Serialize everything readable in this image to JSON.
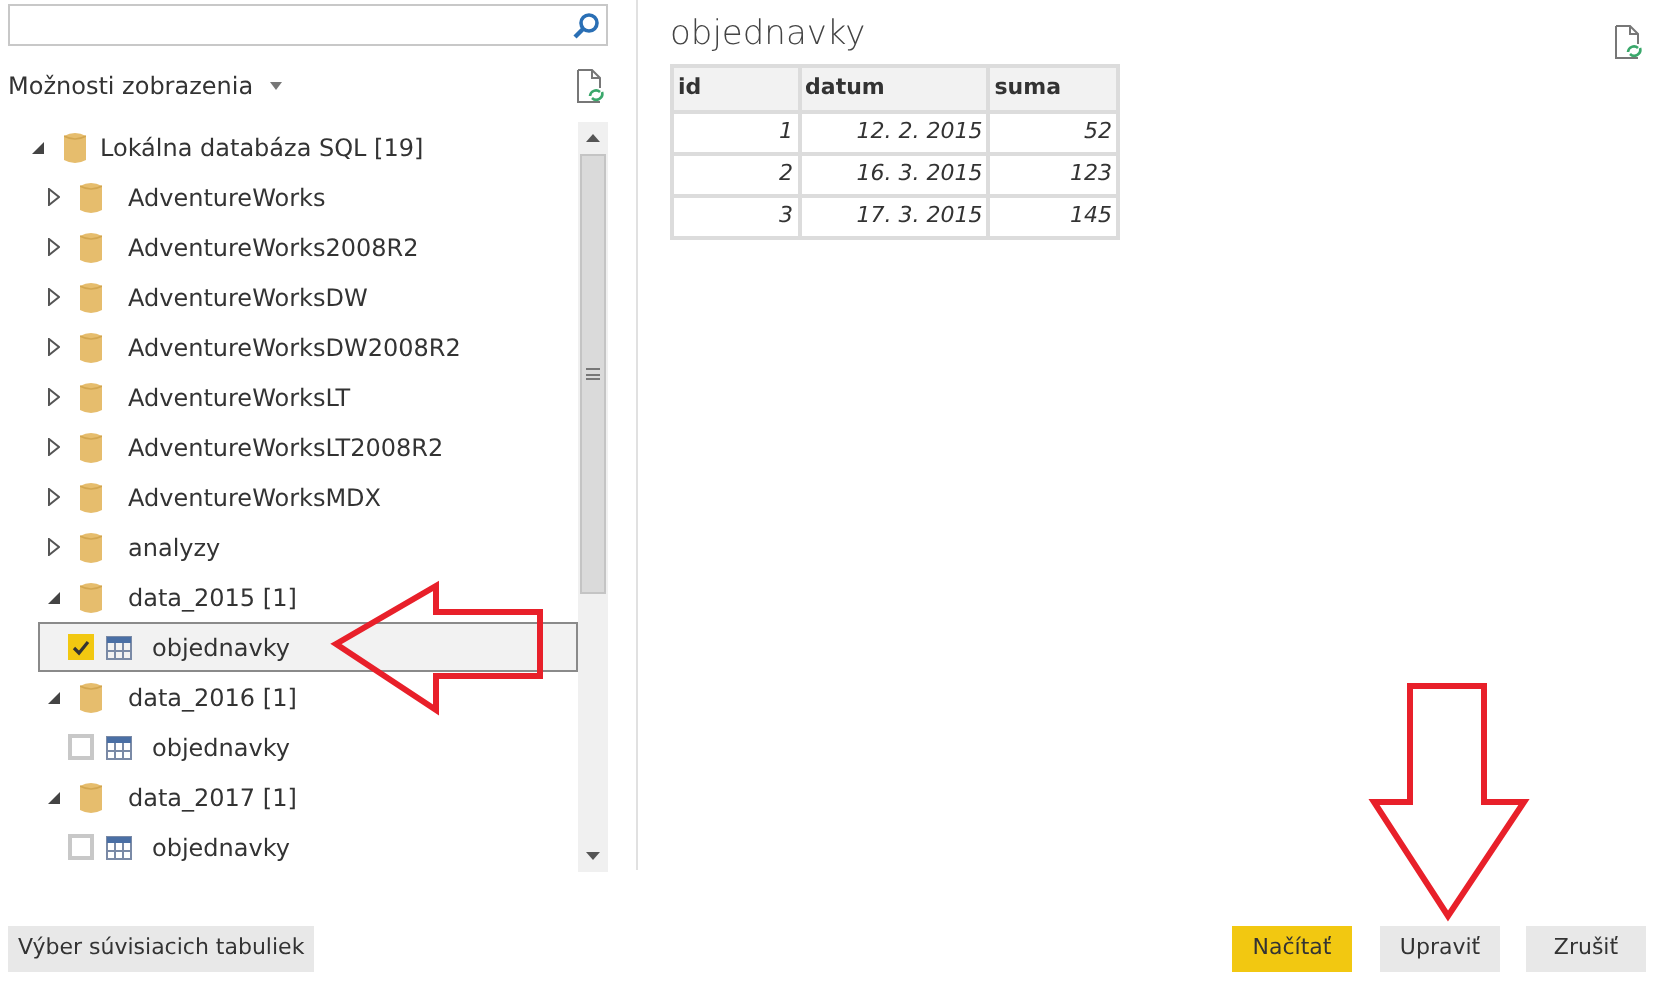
{
  "view_options": {
    "label": "Možnosti zobrazenia"
  },
  "tree": {
    "kind": "database",
    "label": "Lokálna databáza SQL [19]",
    "expanded": true,
    "children": [
      {
        "kind": "database",
        "label": "AdventureWorks",
        "expanded": false
      },
      {
        "kind": "database",
        "label": "AdventureWorks2008R2",
        "expanded": false
      },
      {
        "kind": "database",
        "label": "AdventureWorksDW",
        "expanded": false
      },
      {
        "kind": "database",
        "label": "AdventureWorksDW2008R2",
        "expanded": false
      },
      {
        "kind": "database",
        "label": "AdventureWorksLT",
        "expanded": false
      },
      {
        "kind": "database",
        "label": "AdventureWorksLT2008R2",
        "expanded": false
      },
      {
        "kind": "database",
        "label": "AdventureWorksMDX",
        "expanded": false
      },
      {
        "kind": "database",
        "label": "analyzy",
        "expanded": false
      },
      {
        "kind": "database",
        "label": "data_2015 [1]",
        "expanded": true,
        "children": [
          {
            "kind": "table",
            "label": "objednavky",
            "checked": true,
            "selected": true
          }
        ]
      },
      {
        "kind": "database",
        "label": "data_2016 [1]",
        "expanded": true,
        "children": [
          {
            "kind": "table",
            "label": "objednavky",
            "checked": false,
            "selected": false
          }
        ]
      },
      {
        "kind": "database",
        "label": "data_2017 [1]",
        "expanded": true,
        "children": [
          {
            "kind": "table",
            "label": "objednavky",
            "checked": false,
            "selected": false
          }
        ]
      }
    ]
  },
  "preview": {
    "title": "objednavky",
    "table": {
      "columns": [
        "id",
        "datum",
        "suma"
      ],
      "rows": [
        [
          "1",
          "12. 2. 2015",
          "52"
        ],
        [
          "2",
          "16. 3. 2015",
          "123"
        ],
        [
          "3",
          "17. 3. 2015",
          "145"
        ]
      ]
    }
  },
  "buttons": [
    {
      "kind": "secondary",
      "label": "Výber súvisiacich tabuliek"
    },
    {
      "kind": "primary",
      "label": "Načítať"
    },
    {
      "kind": "secondary",
      "label": "Upraviť"
    },
    {
      "kind": "secondary",
      "label": "Zrušiť"
    }
  ]
}
